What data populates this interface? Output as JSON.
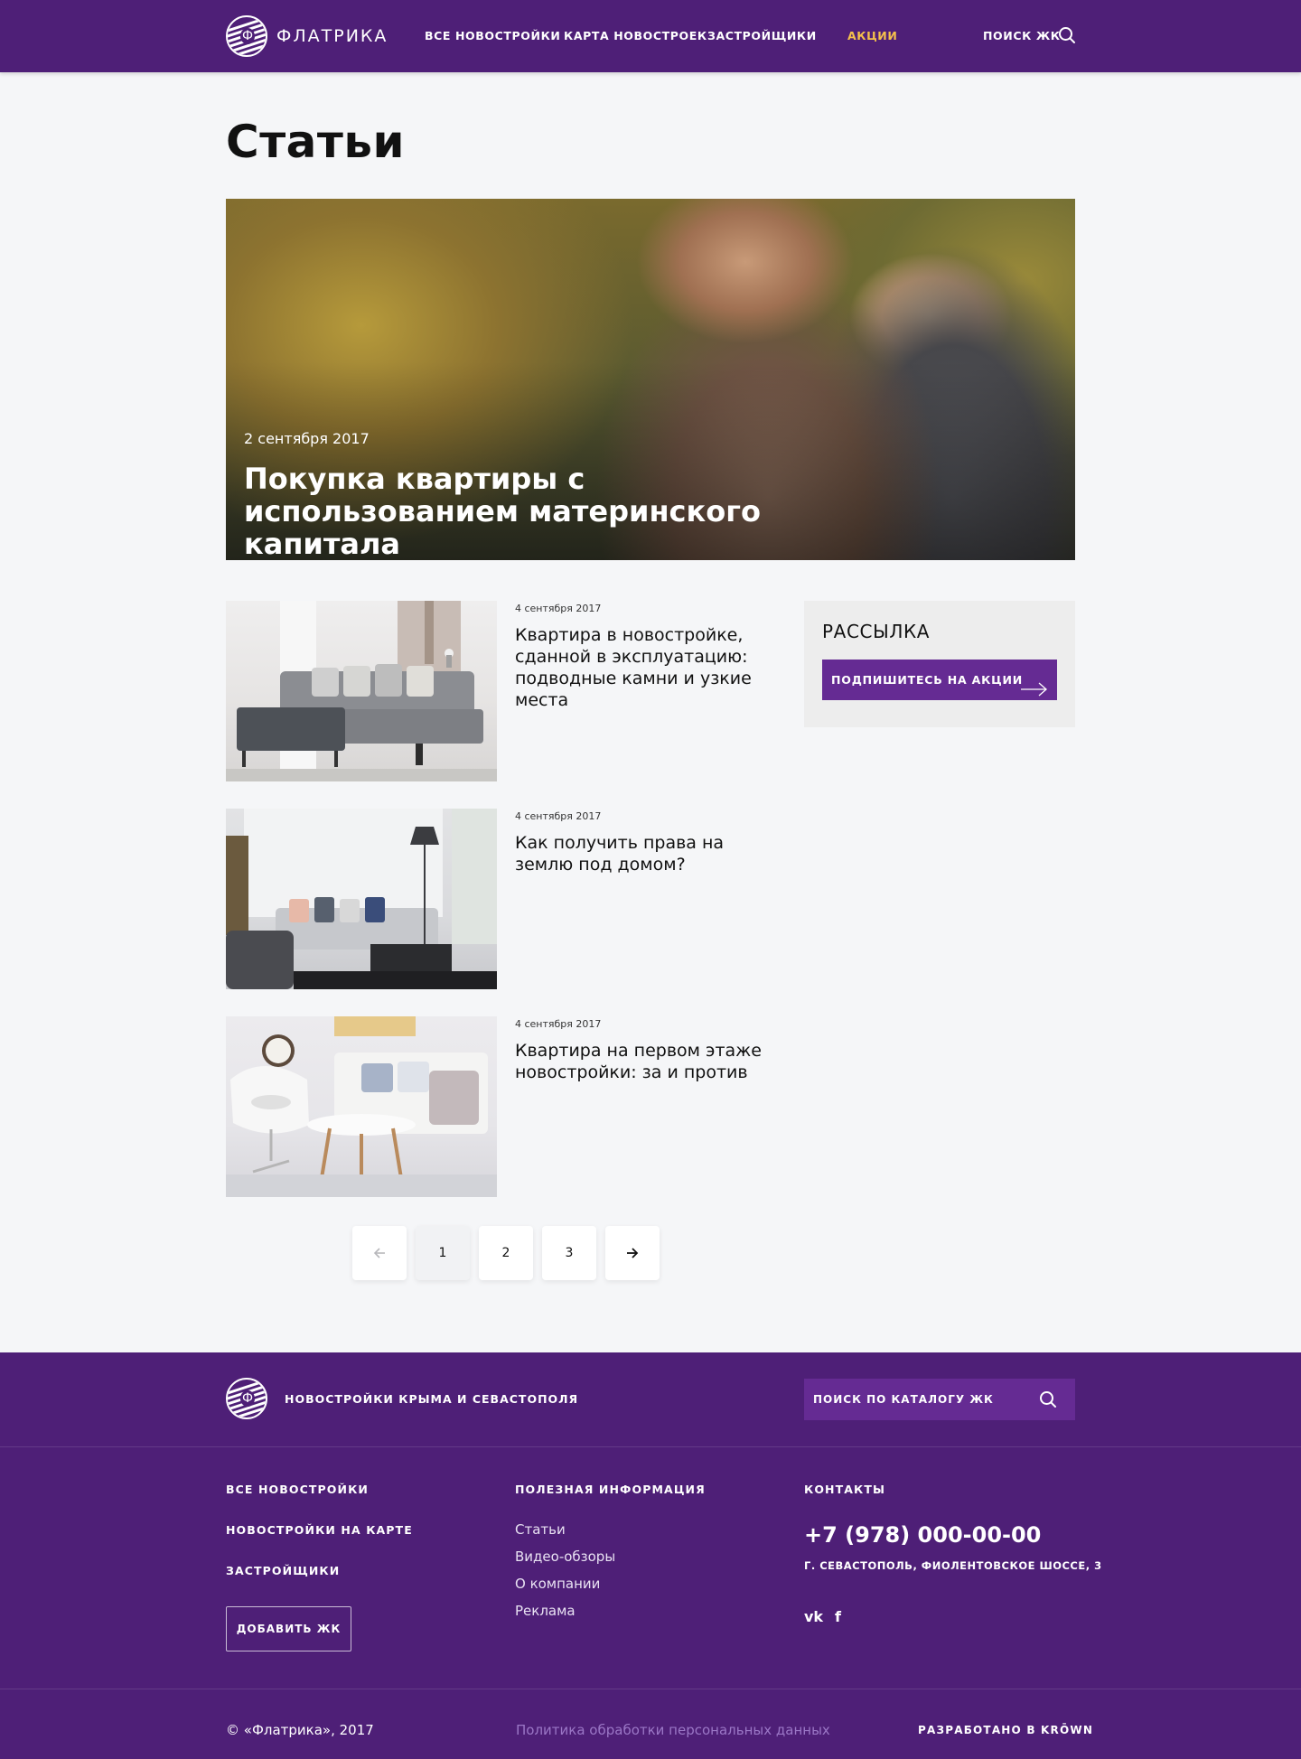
{
  "header": {
    "logo_text": "ФЛАТРИКА",
    "logo_letter": "Ф",
    "nav": [
      "ВСЕ НОВОСТРОЙКИ",
      "КАРТА НОВОСТРОЕК",
      "ЗАСТРОЙЩИКИ",
      "АКЦИИ"
    ],
    "search_label": "ПОИСК ЖК",
    "accent_color": "#f5c14b"
  },
  "page_title": "Статьи",
  "hero": {
    "date": "2 сентября 2017",
    "title": "Покупка квартиры с использованием материнского капитала"
  },
  "articles": [
    {
      "date": "4 сентября 2017",
      "title": "Квартира в новостройке, сданной в эксплуатацию: подводные камни и узкие места"
    },
    {
      "date": "4 сентября 2017",
      "title": "Как получить права на землю под домом?"
    },
    {
      "date": "4 сентября 2017",
      "title": "Квартира на первом этаже новостройки: за и против"
    }
  ],
  "newsletter": {
    "title": "РАССЫЛКА",
    "button": "ПОДПИШИТЕСЬ НА АКЦИИ"
  },
  "pagination": {
    "prev": "←",
    "pages": [
      "1",
      "2",
      "3"
    ],
    "next": "→",
    "current": "1"
  },
  "footer": {
    "tagline": "НОВОСТРОЙКИ КРЫМА И СЕВАСТОПОЛЯ",
    "search_placeholder": "ПОИСК ПО КАТАЛОГУ ЖК",
    "col1": {
      "links": [
        "ВСЕ НОВОСТРОЙКИ",
        "НОВОСТРОЙКИ НА КАРТЕ",
        "ЗАСТРОЙЩИКИ"
      ],
      "add_button": "ДОБАВИТЬ ЖК"
    },
    "col2": {
      "heading": "ПОЛЕЗНАЯ ИНФОРМАЦИЯ",
      "links": [
        "Статьи",
        "Видео-обзоры",
        "О компании",
        "Реклама"
      ]
    },
    "col3": {
      "heading": "КОНТАКТЫ",
      "phone": "+7 (978) 000-00-00",
      "address": "Г. СЕВАСТОПОЛЬ, ФИОЛЕНТОВСКОЕ ШОССЕ, 3",
      "social": [
        "vk",
        "f"
      ]
    },
    "copyright": "© «Флатрика», 2017",
    "policy": "Политика обработки персональных данных",
    "developer": "РАЗРАБОТАНО В KRŌWN"
  },
  "colors": {
    "brand": "#4e1f77",
    "brand_light": "#652b93",
    "link_muted": "#9b77c6"
  }
}
